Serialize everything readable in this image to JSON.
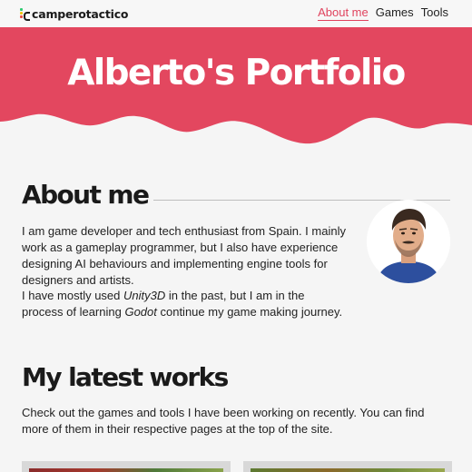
{
  "navbar": {
    "brand": "camperotactico",
    "links": [
      {
        "label": "About me",
        "active": true
      },
      {
        "label": "Games",
        "active": false
      },
      {
        "label": "Tools",
        "active": false
      }
    ]
  },
  "hero": {
    "title": "Alberto's Portfolio"
  },
  "about": {
    "heading": "About me",
    "paragraph1": "I am game developer and tech enthusiast from Spain. I mainly work as a gameplay programmer, but I also have experience designing AI behaviours and implementing engine tools for designers and artists.",
    "paragraph2_prefix": "I have mostly used ",
    "paragraph2_em1": "Unity3D",
    "paragraph2_mid": " in the past, but I am in the process of learning ",
    "paragraph2_em2": "Godot",
    "paragraph2_suffix": " continue my game making journey."
  },
  "works": {
    "heading": "My latest works",
    "intro": "Check out the games and tools I have been working on recently. You can find more of them in their respective pages at the top of the site."
  },
  "colors": {
    "accent": "#e0435e",
    "hero_bg": "#e3475f"
  }
}
